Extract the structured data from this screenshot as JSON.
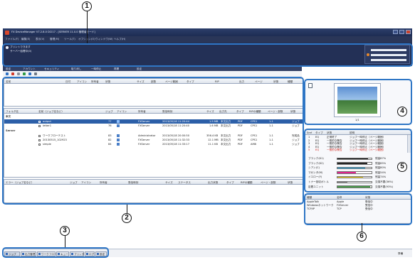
{
  "callouts": [
    "1",
    "2",
    "3",
    "4",
    "5",
    "6"
  ],
  "window": {
    "title": "FX DeviceManager V7.2.8.0 DCI17 - [SERVER 11.0.0 管理者モード]",
    "controls": [
      "minimize-icon",
      "maximize-icon",
      "close-icon"
    ]
  },
  "menu": [
    "ファイル(F)",
    "編集(E)",
    "表示(V)",
    "管理(M)",
    "ツール(T)",
    "オプション(O)",
    "ウィンドウ(W)",
    "ヘルプ(H)"
  ],
  "status": {
    "line1": "プリントできます",
    "line2": "サーバー処理中(0)"
  },
  "toolbar": [
    "設定",
    "アカウント",
    "セキュリティ",
    "取り消し",
    "一時停止",
    "再開",
    "設定"
  ],
  "top_table": {
    "headers": [
      "名前",
      "日付",
      "アイコン",
      "所有者",
      "状態",
      "サイズ",
      "部数",
      "ページ範囲",
      "タイプ",
      "RIP",
      "出力",
      "ページ",
      "状態",
      "種類"
    ]
  },
  "job_table": {
    "headers": [
      "フォルダ名",
      "名前（ジョブ名など）",
      "ジョブ",
      "アイコン",
      "所有者",
      "受信時刻",
      "サイズ",
      "出力先",
      "タイプ",
      "RIPの種類",
      "ページ・部数",
      "状態"
    ],
    "groups": [
      {
        "name": "本文",
        "rows": [
          {
            "name": "output",
            "job": "77",
            "owner": "FXServer",
            "time": "2013/05/18 11:20:44",
            "size": "1.9 MB",
            "dest": "本文出力",
            "type": "PDF",
            "rip": "CPS1",
            "pages": "1-1",
            "status": "ジョブ",
            "selected": true
          },
          {
            "name": "letter1",
            "job": "76",
            "owner": "FXServer",
            "time": "2013/05/18 11:20:40",
            "size": "1.6 MB",
            "dest": "本文出力",
            "type": "PDF",
            "rip": "CPS1",
            "pages": "1-1",
            "status": "ジョブ",
            "selected": false
          }
        ]
      },
      {
        "name": "Server",
        "rows": [
          {
            "name": "ワークフローテスト",
            "job": "83",
            "owner": "Administrator",
            "time": "2013/05/18 20:00:50",
            "size": "356.4 KB",
            "dest": "本文出力",
            "type": "PDF",
            "rip": "CPS1",
            "pages": "1-1",
            "status": "完成品",
            "selected": false
          },
          {
            "name": "20130515_102923",
            "job": "82",
            "owner": "FXServer",
            "time": "2013/05/18 11:32:33",
            "size": "12.1 MB",
            "dest": "本文出力",
            "type": "PDF",
            "rip": "CPS1",
            "pages": "1-1",
            "status": "ジョブ",
            "selected": false
          },
          {
            "name": "simple",
            "job": "84",
            "owner": "FXServer",
            "time": "2013/05/18 11:33:17",
            "size": "11.1 KB",
            "dest": "本文出力",
            "type": "PDF",
            "rip": "AMB",
            "pages": "1-1",
            "status": "ジョブ",
            "selected": false
          }
        ]
      }
    ]
  },
  "error_table": {
    "headers": [
      "エラー（ジョブ名など）",
      "ジョブ",
      "アイコン",
      "所有者",
      "受信時刻",
      "サイズ",
      "ステータス",
      "出力状態",
      "タイプ",
      "RIPの種類",
      "ページ・部数",
      "状態"
    ]
  },
  "preview": {
    "page_label": "1/1"
  },
  "log": {
    "headers": [
      "Sref",
      "タイプ",
      "状態",
      "説明"
    ],
    "rows": [
      {
        "sref": "1",
        "type": "EQ",
        "state": "正常終了",
        "desc": "ジョブ一時停止（ページ範囲）",
        "highlight": false
      },
      {
        "sref": "2",
        "type": "EQ",
        "state": "一般的な警告",
        "desc": "ジョブ一時停止（ページ範囲）",
        "highlight": false
      },
      {
        "sref": "3",
        "type": "EQ",
        "state": "一般的な警告",
        "desc": "ジョブ一時停止（ページ範囲）",
        "highlight": false
      },
      {
        "sref": "4",
        "type": "EQ",
        "state": "一般的な警告",
        "desc": "ジョブ一時停止（ページ範囲）",
        "highlight": false
      },
      {
        "sref": "5",
        "type": "EQ",
        "state": "一般的な警告",
        "desc": "ジョブ一時停止（ページ範囲）",
        "highlight": true
      }
    ]
  },
  "toner": [
    {
      "name": "ブラック(K1)",
      "level": 0.9,
      "color": "#111111",
      "status": "残量87%"
    },
    {
      "name": "ブラック(K2)",
      "level": 0.88,
      "color": "#222222",
      "status": "残量85%"
    },
    {
      "name": "シアン(C)",
      "level": 0.82,
      "color": "#1aa3e0",
      "status": "残量80%"
    },
    {
      "name": "マゼンタ(M)",
      "level": 0.55,
      "color": "#e0238c",
      "status": "残量54%"
    },
    {
      "name": "イエロー(Y)",
      "level": 0.75,
      "color": "#f2d21b",
      "status": "残量74%"
    },
    {
      "name": "トナー回収ボトル",
      "level": 0.3,
      "color": "#8a8a8a",
      "status": "交換不要(36%)"
    },
    {
      "name": "定着ユニット",
      "level": 0.95,
      "color": "#4a9a4a",
      "status": "交換不要(93%)"
    }
  ],
  "connections": {
    "headers": [
      "種類",
      "名称",
      "状態"
    ],
    "rows": [
      {
        "type": "AppleTalk",
        "name": "Apple",
        "state": "受信中"
      },
      {
        "type": "Windowsネットワーク",
        "name": "FXServer",
        "state": "受信中"
      },
      {
        "type": "TCP/IP",
        "name": "TCP",
        "state": "受信中"
      }
    ]
  },
  "bottom_tabs": [
    "ジョブ",
    "出力管理",
    "ワークフロー",
    "キュー",
    "プリンタ",
    "ログ",
    "設定"
  ],
  "status_right": "準備"
}
